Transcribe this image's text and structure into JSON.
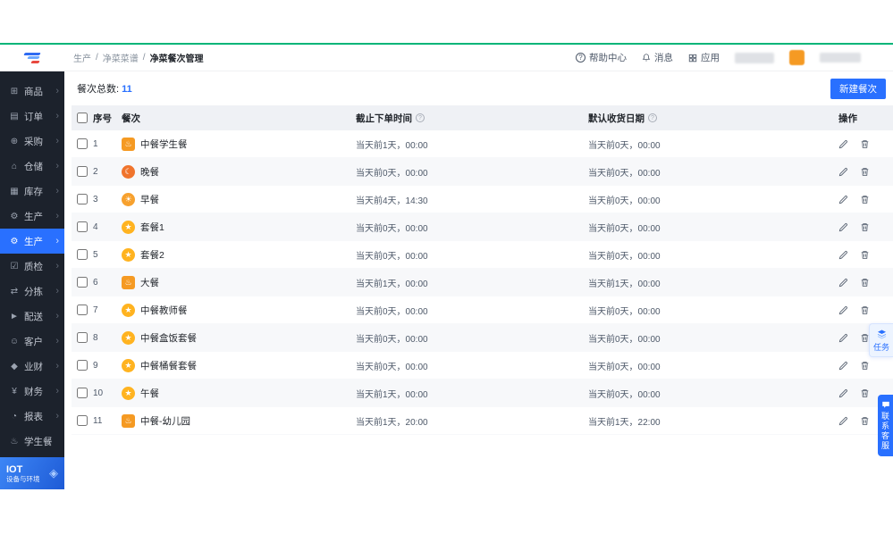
{
  "breadcrumb": [
    "生产",
    "净菜菜谱",
    "净菜餐次管理"
  ],
  "topbar": {
    "help": "帮助中心",
    "message": "消息",
    "apps": "应用"
  },
  "icons": {
    "help": "?",
    "info": "?",
    "chevron": "›",
    "cube": "◈"
  },
  "sidebar": {
    "items": [
      {
        "label": "商品",
        "icon": "grid"
      },
      {
        "label": "订单",
        "icon": "order"
      },
      {
        "label": "采购",
        "icon": "cart"
      },
      {
        "label": "仓储",
        "icon": "house"
      },
      {
        "label": "库存",
        "icon": "stock"
      },
      {
        "label": "生产",
        "icon": "factory"
      },
      {
        "label": "生产",
        "icon": "factory",
        "active": true
      },
      {
        "label": "质检",
        "icon": "check"
      },
      {
        "label": "分拣",
        "icon": "sort"
      },
      {
        "label": "配送",
        "icon": "truck"
      },
      {
        "label": "客户",
        "icon": "users"
      },
      {
        "label": "业财",
        "icon": "biz"
      },
      {
        "label": "财务",
        "icon": "money"
      },
      {
        "label": "报表",
        "icon": "report"
      },
      {
        "label": "学生餐",
        "icon": "meal",
        "chevron": false
      }
    ],
    "iot": {
      "title": "IOT",
      "subtitle": "设备与环境"
    }
  },
  "toolbar": {
    "total_label": "餐次总数:",
    "total_value": "11",
    "create_button": "新建餐次"
  },
  "table": {
    "headers": [
      "序号",
      "餐次",
      "截止下单时间",
      "默认收货日期",
      "操作"
    ],
    "rows": [
      {
        "no": "1",
        "name": "中餐学生餐",
        "deadline": "当天前1天，00:00",
        "receive": "当天前0天，00:00",
        "icon": "hot",
        "icon_shape": "square",
        "icon_color": "#F59A23"
      },
      {
        "no": "2",
        "name": "晚餐",
        "deadline": "当天前0天，00:00",
        "receive": "当天前0天，00:00",
        "icon": "moon",
        "icon_shape": "circle",
        "icon_color": "#F0742C"
      },
      {
        "no": "3",
        "name": "早餐",
        "deadline": "当天前4天，14:30",
        "receive": "当天前0天，00:00",
        "icon": "sun",
        "icon_shape": "circle",
        "icon_color": "#F7A12E"
      },
      {
        "no": "4",
        "name": "套餐1",
        "deadline": "当天前0天，00:00",
        "receive": "当天前0天，00:00",
        "icon": "star",
        "icon_shape": "circle",
        "icon_color": "#FFB320"
      },
      {
        "no": "5",
        "name": "套餐2",
        "deadline": "当天前0天，00:00",
        "receive": "当天前0天，00:00",
        "icon": "star",
        "icon_shape": "circle",
        "icon_color": "#FFB320"
      },
      {
        "no": "6",
        "name": "大餐",
        "deadline": "当天前1天，00:00",
        "receive": "当天前1天，00:00",
        "icon": "hot",
        "icon_shape": "square",
        "icon_color": "#F59A23"
      },
      {
        "no": "7",
        "name": "中餐教师餐",
        "deadline": "当天前0天，00:00",
        "receive": "当天前0天，00:00",
        "icon": "star",
        "icon_shape": "circle",
        "icon_color": "#FFB320"
      },
      {
        "no": "8",
        "name": "中餐盒饭套餐",
        "deadline": "当天前0天，00:00",
        "receive": "当天前0天，00:00",
        "icon": "star",
        "icon_shape": "circle",
        "icon_color": "#FFB320"
      },
      {
        "no": "9",
        "name": "中餐桶餐套餐",
        "deadline": "当天前0天，00:00",
        "receive": "当天前0天，00:00",
        "icon": "star",
        "icon_shape": "circle",
        "icon_color": "#FFB320"
      },
      {
        "no": "10",
        "name": "午餐",
        "deadline": "当天前1天，00:00",
        "receive": "当天前0天，00:00",
        "icon": "star",
        "icon_shape": "circle",
        "icon_color": "#FFB320"
      },
      {
        "no": "11",
        "name": "中餐-幼儿园",
        "deadline": "当天前1天，20:00",
        "receive": "当天前1天，22:00",
        "icon": "hot",
        "icon_shape": "square",
        "icon_color": "#F59A23"
      }
    ]
  },
  "floating": {
    "task": "任务",
    "service": "联系客服"
  }
}
